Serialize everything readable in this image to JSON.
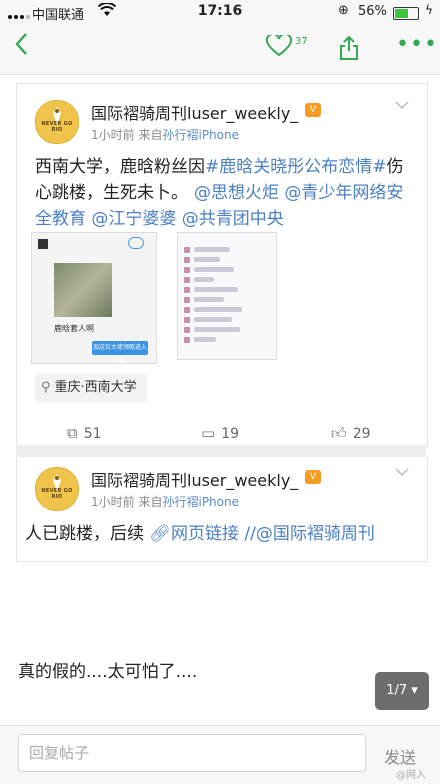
{
  "status_bar": {
    "carrier": "中国联通",
    "time": "17:16",
    "battery_percent": "56%",
    "battery_level": 0.56,
    "wifi_icon": "wifi-icon",
    "orientation_lock_icon": "rotation-lock-icon"
  },
  "nav": {
    "back_icon": "chevron-left-icon",
    "like_count": "37",
    "like_icon": "heart-icon",
    "share_icon": "share-icon",
    "more_icon": "more-dots-icon",
    "accent_color": "#34a853"
  },
  "posts": [
    {
      "username": "国际褶骑周刊luser_weekly_",
      "time_ago": "1小时前",
      "source_prefix": "来自",
      "source": "孙行褶iPhone",
      "text_plain_1": "西南大学，鹿晗粉丝因",
      "text_tag_1": "#鹿晗关晓彤公布恋情#",
      "text_plain_2": "伤心跳楼，生死未卜。",
      "text_mentions": "@思想火炬 @青少年网络安全教育 @江宁婆婆 @共青团中央",
      "location": "重庆·西南大学",
      "reposts": "51",
      "comments": "19",
      "likes": "29",
      "thumb_caption": "鹿晗套人啊",
      "thumb_button": "加这位大佬领取进入门槛"
    },
    {
      "username": "国际褶骑周刊luser_weekly_",
      "time_ago": "1小时前",
      "source_prefix": "来自",
      "source": "孙行褶iPhone",
      "text_plain": "人已跳楼，后续",
      "link_text": "网页链接",
      "text_mention": "//@国际褶骑周刊"
    }
  ],
  "comment": {
    "text": "真的假的....太可怕了...."
  },
  "pager": {
    "label": "1/7 ▾"
  },
  "reply": {
    "placeholder": "回复帖子",
    "send_label": "发送"
  },
  "watermark": "@网入"
}
